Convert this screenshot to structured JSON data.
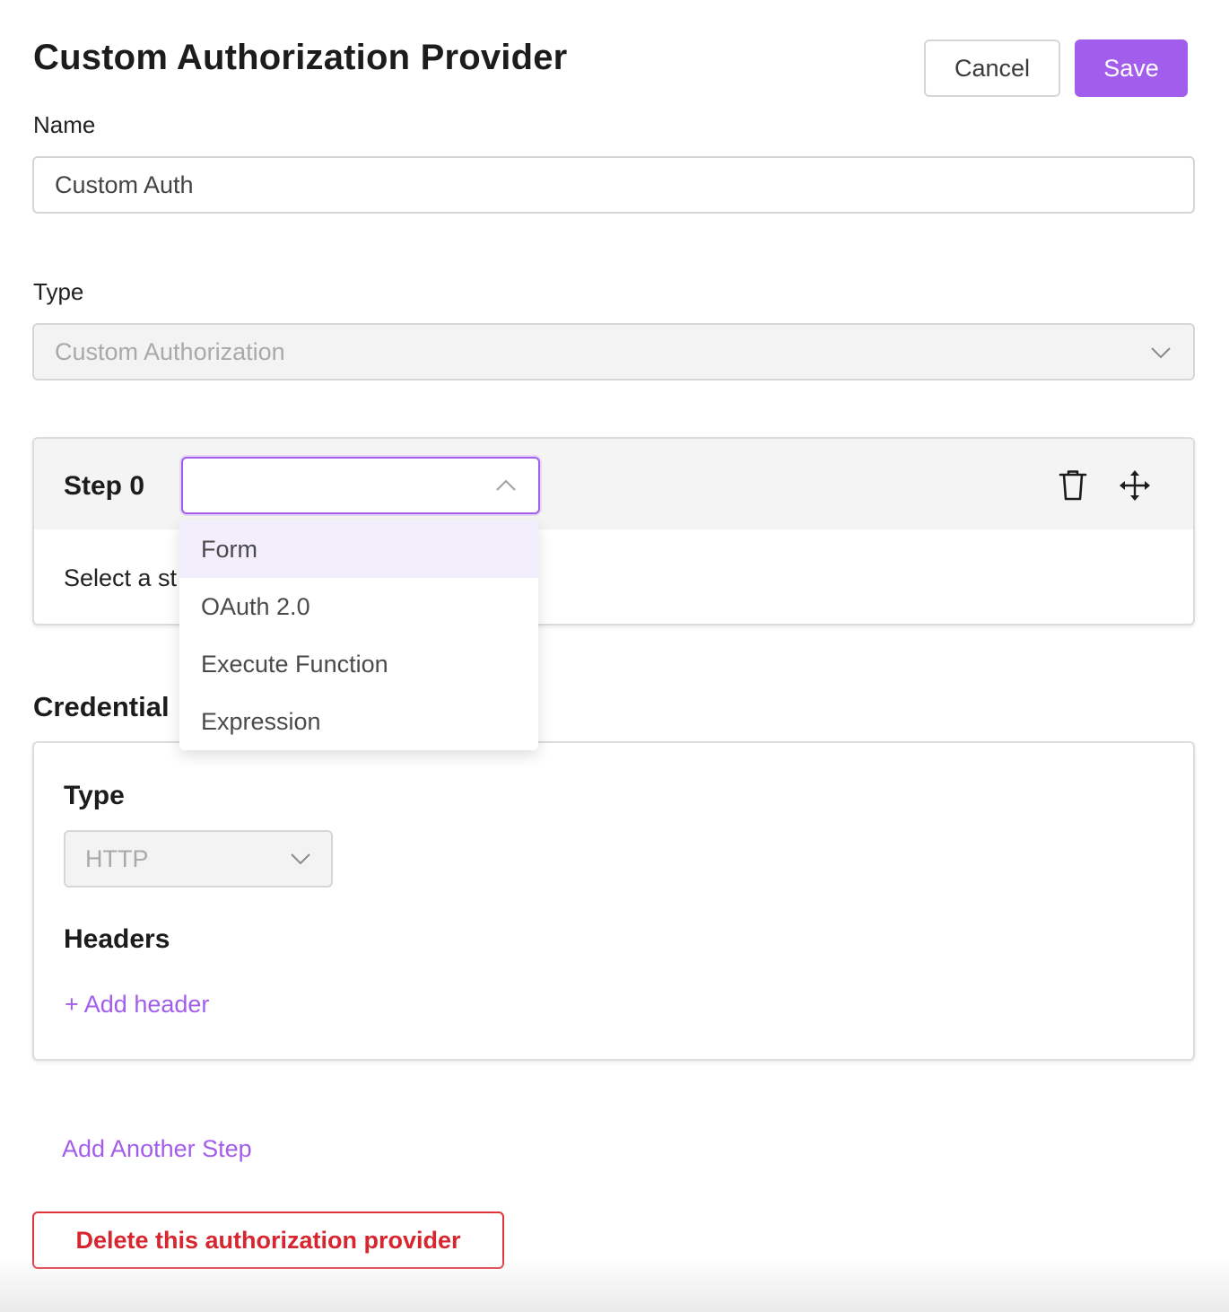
{
  "header": {
    "title": "Custom Authorization Provider",
    "cancel_label": "Cancel",
    "save_label": "Save"
  },
  "name_field": {
    "label": "Name",
    "value": "Custom Auth"
  },
  "type_field": {
    "label": "Type",
    "value": "Custom Authorization",
    "icon": "chevron-down-icon"
  },
  "step": {
    "title": "Step 0",
    "select_value": "",
    "body_text": "Select a st",
    "icons": [
      "trash-icon",
      "move-icon",
      "chevron-up-icon"
    ],
    "dropdown_options": [
      {
        "label": "Form",
        "highlighted": true
      },
      {
        "label": "OAuth 2.0",
        "highlighted": false
      },
      {
        "label": "Execute Function",
        "highlighted": false
      },
      {
        "label": "Expression",
        "highlighted": false
      }
    ]
  },
  "credentials": {
    "title": "Credential",
    "type_label": "Type",
    "type_value": "HTTP",
    "headers_label": "Headers",
    "add_header_label": "+ Add header"
  },
  "add_step_label": "Add Another Step",
  "delete_label": "Delete this authorization provider",
  "colors": {
    "accent": "#a35ded",
    "danger": "#d6262f",
    "highlight": "#f3eefc",
    "border": "#d6d6d6"
  }
}
